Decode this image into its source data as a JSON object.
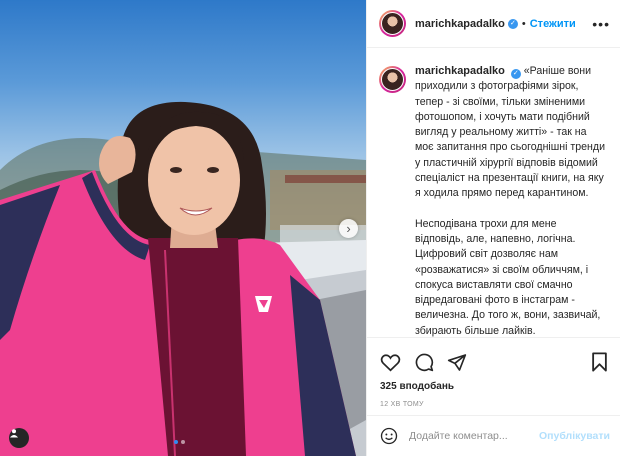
{
  "post": {
    "username": "marichkapadalko",
    "separator": "•",
    "follow_label": "Стежити",
    "more_label": "•••",
    "caption_paragraphs": [
      "«Раніше вони приходили з фотографіями зірок, тепер - зі своїми, тільки зміненими фотошопом, і хочуть мати подібний вигляд у реальному житті» - так на моє запитання про сьогоднішні тренди у пластичній хірургії відповів відомий спеціаліст на презентації книги, на яку я ходила прямо перед карантином.",
      "Несподівана трохи для мене відповідь, але, напевно, логічна. Цифровий світ дозволяє нам «розважатися» зі своїм обличчям, і спокуса виставляти свої смачно відредаговані фото в інстаграм - величезна. До того ж, вони, зазвичай, збирають більше лайків."
    ],
    "likes": "325 вподобань",
    "time": "12 ХВ ТОМУ",
    "comment_placeholder": "Додайте коментар...",
    "publish_label": "Опублікувати",
    "carousel": {
      "total": 2,
      "active": 1
    }
  },
  "icons": {
    "verified": "verified-badge-icon",
    "like": "heart-icon",
    "comment": "comment-icon",
    "share": "paper-plane-icon",
    "save": "bookmark-icon",
    "emoji": "smiley-icon",
    "next": "chevron-right-icon",
    "tags": "user-tag-icon"
  },
  "colors": {
    "accent": "#0095f6",
    "jacket": "#ee3f8f",
    "verified": "#3897f0"
  }
}
